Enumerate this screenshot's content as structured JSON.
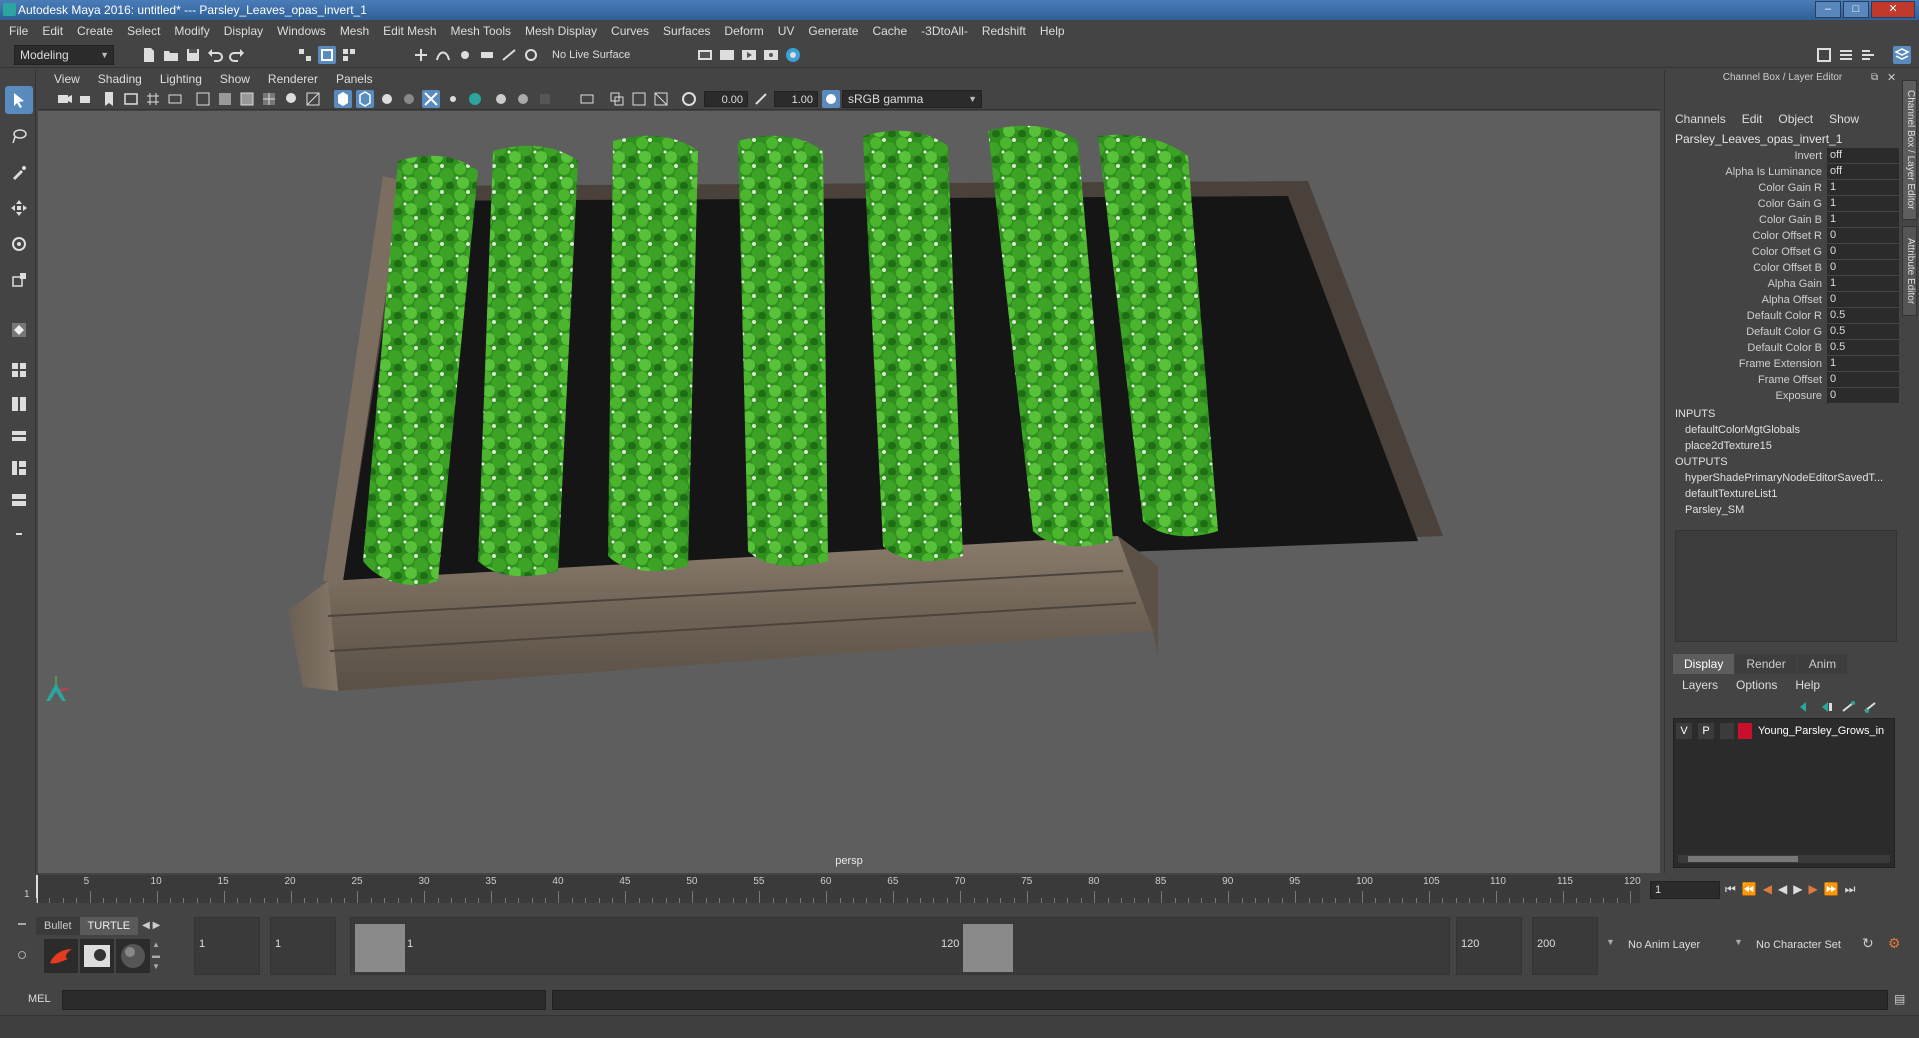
{
  "window": {
    "title": "Autodesk Maya 2016: untitled*   ---   Parsley_Leaves_opas_invert_1"
  },
  "menubar": [
    "File",
    "Edit",
    "Create",
    "Select",
    "Modify",
    "Display",
    "Windows",
    "Mesh",
    "Edit Mesh",
    "Mesh Tools",
    "Mesh Display",
    "Curves",
    "Surfaces",
    "Deform",
    "UV",
    "Generate",
    "Cache",
    "-3DtoAll-",
    "Redshift",
    "Help"
  ],
  "statusline": {
    "mode": "Modeling",
    "live_surface": "No Live Surface"
  },
  "panel": {
    "menus": [
      "View",
      "Shading",
      "Lighting",
      "Show",
      "Renderer",
      "Panels"
    ],
    "exposure": "0.00",
    "gamma": "1.00",
    "color_space": "sRGB gamma",
    "camera": "persp"
  },
  "channel_box": {
    "header": "Channel Box / Layer Editor",
    "menus": [
      "Channels",
      "Edit",
      "Object",
      "Show"
    ],
    "node": "Parsley_Leaves_opas_invert_1",
    "attributes": [
      {
        "name": "Invert",
        "value": "off"
      },
      {
        "name": "Alpha Is Luminance",
        "value": "off"
      },
      {
        "name": "Color Gain R",
        "value": "1"
      },
      {
        "name": "Color Gain G",
        "value": "1"
      },
      {
        "name": "Color Gain B",
        "value": "1"
      },
      {
        "name": "Color Offset R",
        "value": "0"
      },
      {
        "name": "Color Offset G",
        "value": "0"
      },
      {
        "name": "Color Offset B",
        "value": "0"
      },
      {
        "name": "Alpha Gain",
        "value": "1"
      },
      {
        "name": "Alpha Offset",
        "value": "0"
      },
      {
        "name": "Default Color R",
        "value": "0.5"
      },
      {
        "name": "Default Color G",
        "value": "0.5"
      },
      {
        "name": "Default Color B",
        "value": "0.5"
      },
      {
        "name": "Frame Extension",
        "value": "1"
      },
      {
        "name": "Frame Offset",
        "value": "0"
      },
      {
        "name": "Exposure",
        "value": "0"
      }
    ],
    "inputs_label": "INPUTS",
    "inputs": [
      "defaultColorMgtGlobals",
      "place2dTexture15"
    ],
    "outputs_label": "OUTPUTS",
    "outputs": [
      "hyperShadePrimaryNodeEditorSavedT...",
      "defaultTextureList1",
      "Parsley_SM"
    ],
    "side_tabs": [
      "Channel Box / Layer Editor",
      "Attribute Editor"
    ]
  },
  "layer_editor": {
    "tabs": [
      "Display",
      "Render",
      "Anim"
    ],
    "menus": [
      "Layers",
      "Options",
      "Help"
    ],
    "layer": {
      "v": "V",
      "p": "P",
      "name": "Young_Parsley_Grows_in",
      "color": "#c8102e"
    }
  },
  "timeslider": {
    "ticks": [
      "5",
      "10",
      "15",
      "20",
      "25",
      "30",
      "35",
      "40",
      "45",
      "50",
      "55",
      "60",
      "65",
      "70",
      "75",
      "80",
      "85",
      "90",
      "95",
      "100",
      "105",
      "110",
      "115",
      "120"
    ],
    "start_label": "1",
    "current_frame": "1"
  },
  "rangeslider": {
    "shelf_tabs": [
      "Bullet",
      "TURTLE"
    ],
    "start": "1",
    "playback_start": "1",
    "range_start_label": "1",
    "range_end_label": "120",
    "playback_end": "120",
    "end": "200",
    "anim_layer": "No Anim Layer",
    "character_set": "No Character Set"
  },
  "cmdline": {
    "label": "MEL"
  },
  "colors": {
    "accent": "#5a8bbf",
    "viewport_bg": "#5e5e5e",
    "panel_bg": "#444444",
    "field_bg": "#2b2b2b"
  }
}
